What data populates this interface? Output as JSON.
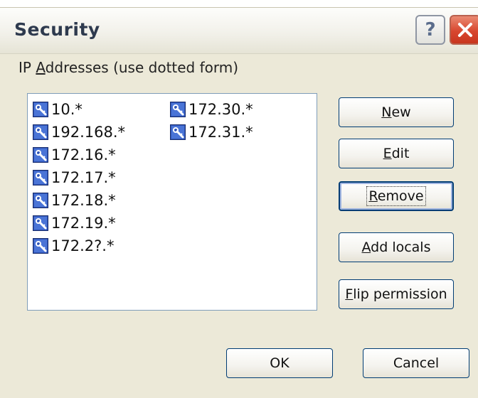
{
  "dialog": {
    "title": "Security",
    "help_glyph": "?",
    "close_icon": "close-icon"
  },
  "ip_list": {
    "label_prefix": "IP ",
    "label_accel": "A",
    "label_rest": "ddresses (use dotted form)",
    "column1": [
      "10.*",
      "192.168.*",
      "172.16.*",
      "172.17.*",
      "172.18.*",
      "172.19.*",
      "172.2?.*"
    ],
    "column2": [
      "172.30.*",
      "172.31.*"
    ],
    "item_icon": "network-key-icon"
  },
  "buttons": {
    "new": {
      "accel": "N",
      "rest": "ew"
    },
    "edit": {
      "accel": "E",
      "rest": "dit"
    },
    "remove": {
      "accel": "R",
      "rest": "emove"
    },
    "add_locals": {
      "accel": "A",
      "rest": "dd locals"
    },
    "flip_permission": {
      "accel": "F",
      "rest": "lip permission"
    },
    "ok": "OK",
    "cancel": "Cancel"
  },
  "colors": {
    "window_bg": "#ece9d8",
    "button_border": "#003c74",
    "close_red": "#d8472f"
  }
}
